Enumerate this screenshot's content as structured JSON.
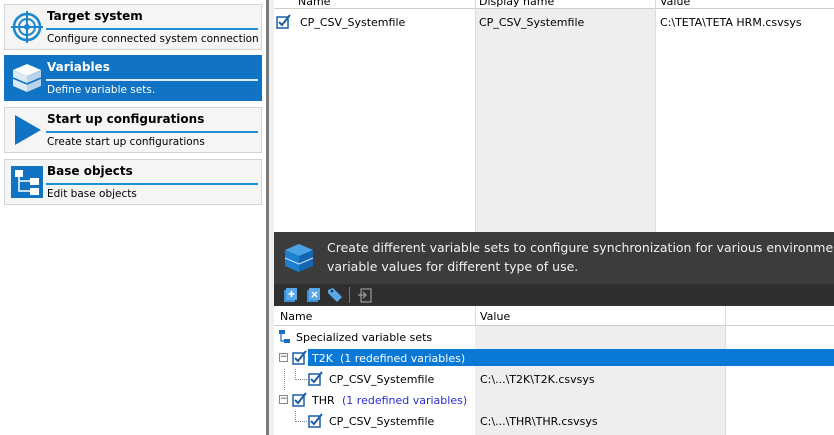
{
  "nav": {
    "items": [
      {
        "title": "Target system",
        "desc": "Configure connected system connection",
        "icon": "target-icon",
        "active": false
      },
      {
        "title": "Variables",
        "desc": "Define variable sets.",
        "icon": "variables-icon",
        "active": true
      },
      {
        "title": "Start up configurations",
        "desc": "Create start up configurations",
        "icon": "play-icon",
        "active": false
      },
      {
        "title": "Base objects",
        "desc": "Edit base objects",
        "icon": "hierarchy-icon",
        "active": false
      }
    ]
  },
  "top_grid": {
    "columns": [
      "Name",
      "Display name",
      "Value"
    ],
    "rows": [
      {
        "name": "CP_CSV_Systemfile",
        "display_name": "CP_CSV_Systemfile",
        "value": "C:\\TETA\\TETA HRM.csvsys"
      }
    ]
  },
  "banner": {
    "line1": "Create different variable sets to configure synchronization for various environments",
    "line2": "variable values for different type of use.",
    "icon": "variables-icon"
  },
  "toolbar": {
    "buttons": [
      "add-set-icon",
      "add-variable-icon",
      "tag-icon",
      "export-icon"
    ]
  },
  "bottom_grid": {
    "columns": [
      "Name",
      "Value"
    ],
    "root": "Specialized variable sets",
    "sets": [
      {
        "name": "T2K",
        "count": "(1 redefined variables)",
        "selected": true,
        "variables": [
          {
            "name": "CP_CSV_Systemfile",
            "value": "C:\\...\\T2K\\T2K.csvsys"
          }
        ]
      },
      {
        "name": "THR",
        "count": "(1 redefined variables)",
        "selected": false,
        "variables": [
          {
            "name": "CP_CSV_Systemfile",
            "value": "C:\\...\\THR\\THR.csvsys"
          }
        ]
      }
    ]
  },
  "colors": {
    "accent": "#1173c4",
    "selection": "#0a79d6",
    "banner_bg": "#3c3c3c",
    "link_blue": "#2b2bd6"
  }
}
